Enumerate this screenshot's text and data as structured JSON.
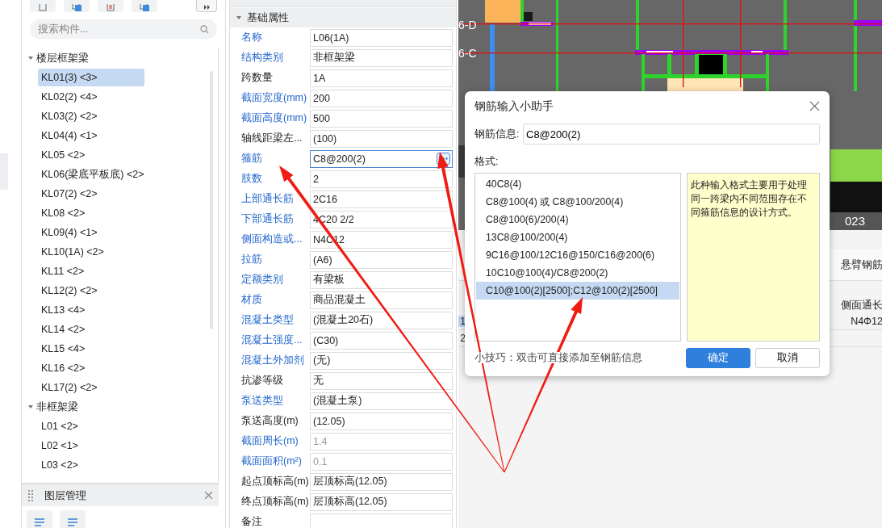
{
  "search": {
    "placeholder": "搜索构件..."
  },
  "tree": [
    {
      "label": "楼层框架梁",
      "expanded": true,
      "children": [
        {
          "label": "KL01(3) <3>",
          "selected": true
        },
        {
          "label": "KL02(2) <4>",
          "selected": false
        },
        {
          "label": "KL03(2) <2>",
          "selected": false
        },
        {
          "label": "KL04(4) <1>",
          "selected": false
        },
        {
          "label": "KL05 <2>",
          "selected": false
        },
        {
          "label": "KL06(梁底平板底) <2>",
          "selected": false
        },
        {
          "label": "KL07(2) <2>",
          "selected": false
        },
        {
          "label": "KL08 <2>",
          "selected": false
        },
        {
          "label": "KL09(4) <1>",
          "selected": false
        },
        {
          "label": "KL10(1A) <2>",
          "selected": false
        },
        {
          "label": "KL11 <2>",
          "selected": false
        },
        {
          "label": "KL12(2) <2>",
          "selected": false
        },
        {
          "label": "KL13 <4>",
          "selected": false
        },
        {
          "label": "KL14 <2>",
          "selected": false
        },
        {
          "label": "KL15 <4>",
          "selected": false
        },
        {
          "label": "KL16 <2>",
          "selected": false
        },
        {
          "label": "KL17(2) <2>",
          "selected": false
        }
      ]
    },
    {
      "label": "非框架梁",
      "expanded": true,
      "children": [
        {
          "label": "L01 <2>",
          "selected": false
        },
        {
          "label": "L02 <1>",
          "selected": false
        },
        {
          "label": "L03 <2>",
          "selected": false
        }
      ]
    }
  ],
  "layer_panel": {
    "title": "图层管理"
  },
  "properties": {
    "group": {
      "label": "基础属性",
      "expanded": true
    },
    "rows": [
      {
        "name": "名称",
        "value": "L06(1A)",
        "linked": true,
        "readonly": false,
        "active": false
      },
      {
        "name": "结构类别",
        "value": "非框架梁",
        "linked": true,
        "readonly": false,
        "active": false
      },
      {
        "name": "跨数量",
        "value": "1A",
        "linked": false,
        "readonly": false,
        "active": false
      },
      {
        "name": "截面宽度(mm)",
        "value": "200",
        "linked": true,
        "readonly": false,
        "active": false
      },
      {
        "name": "截面高度(mm)",
        "value": "500",
        "linked": true,
        "readonly": false,
        "active": false
      },
      {
        "name": "轴线距梁左...",
        "value": "(100)",
        "linked": false,
        "readonly": false,
        "active": false
      },
      {
        "name": "箍筋",
        "value": "C8@200(2)",
        "linked": true,
        "readonly": false,
        "active": true
      },
      {
        "name": "肢数",
        "value": "2",
        "linked": true,
        "readonly": false,
        "active": false
      },
      {
        "name": "上部通长筋",
        "value": "2C16",
        "linked": true,
        "readonly": false,
        "active": false
      },
      {
        "name": "下部通长筋",
        "value": "4C20 2/2",
        "linked": true,
        "readonly": false,
        "active": false
      },
      {
        "name": "侧面构造或...",
        "value": "N4C12",
        "linked": true,
        "readonly": false,
        "active": false
      },
      {
        "name": "拉筋",
        "value": "(A6)",
        "linked": true,
        "readonly": false,
        "active": false
      },
      {
        "name": "定额类别",
        "value": "有梁板",
        "linked": true,
        "readonly": false,
        "active": false
      },
      {
        "name": "材质",
        "value": "商品混凝土",
        "linked": true,
        "readonly": false,
        "active": false
      },
      {
        "name": "混凝土类型",
        "value": "(混凝土20石)",
        "linked": true,
        "readonly": false,
        "active": false
      },
      {
        "name": "混凝土强度...",
        "value": "(C30)",
        "linked": true,
        "readonly": false,
        "active": false
      },
      {
        "name": "混凝土外加剂",
        "value": "(无)",
        "linked": true,
        "readonly": false,
        "active": false
      },
      {
        "name": "抗渗等级",
        "value": "无",
        "linked": false,
        "readonly": false,
        "active": false
      },
      {
        "name": "泵送类型",
        "value": "(混凝土泵)",
        "linked": true,
        "readonly": false,
        "active": false
      },
      {
        "name": "泵送高度(m)",
        "value": "(12.05)",
        "linked": false,
        "readonly": false,
        "active": false
      },
      {
        "name": "截面周长(m)",
        "value": "1.4",
        "linked": true,
        "readonly": true,
        "active": false
      },
      {
        "name": "截面面积(m²)",
        "value": "0.1",
        "linked": true,
        "readonly": true,
        "active": false
      },
      {
        "name": "起点顶标高(m)",
        "value": "层顶标高(12.05)",
        "linked": false,
        "readonly": false,
        "active": false
      },
      {
        "name": "终点顶标高(m)",
        "value": "层顶标高(12.05)",
        "linked": false,
        "readonly": false,
        "active": false
      },
      {
        "name": "备注",
        "linked": false,
        "readonly": false,
        "active": false
      }
    ]
  },
  "cad": {
    "axis_labels": [
      "6-D",
      "6-C"
    ],
    "corner_label": "023"
  },
  "table": {
    "row_numbers": [
      {
        "label": "1",
        "selected": true
      },
      {
        "label": "2",
        "selected": false
      }
    ],
    "header": "悬臂钢筋",
    "column_label": "侧面通长",
    "cell": "N4Φ12"
  },
  "dialog": {
    "title": "钢筋输入小助手",
    "field_label": "钢筋信息:",
    "field_value": "C8@200(2)",
    "formats_label": "格式:",
    "formats": [
      {
        "text": "40C8(4)",
        "selected": false
      },
      {
        "text": "C8@100(4) 或 C8@100/200(4)",
        "selected": false
      },
      {
        "text": "C8@100(6)/200(4)",
        "selected": false
      },
      {
        "text": "13C8@100/200(4)",
        "selected": false
      },
      {
        "text": "9C16@100/12C16@150/C16@200(6)",
        "selected": false
      },
      {
        "text": "10C10@100(4)/C8@200(2)",
        "selected": false
      },
      {
        "text": "C10@100(2)[2500];C12@100(2)[2500]",
        "selected": true
      }
    ],
    "description": "此种输入格式主要用于处理同一跨梁内不同范围存在不同箍筋信息的设计方式。",
    "tip": "小技巧：双击可直接添加至钢筋信息",
    "buttons": [
      {
        "label": "确定",
        "primary": true
      },
      {
        "label": "取消",
        "primary": false
      }
    ]
  }
}
